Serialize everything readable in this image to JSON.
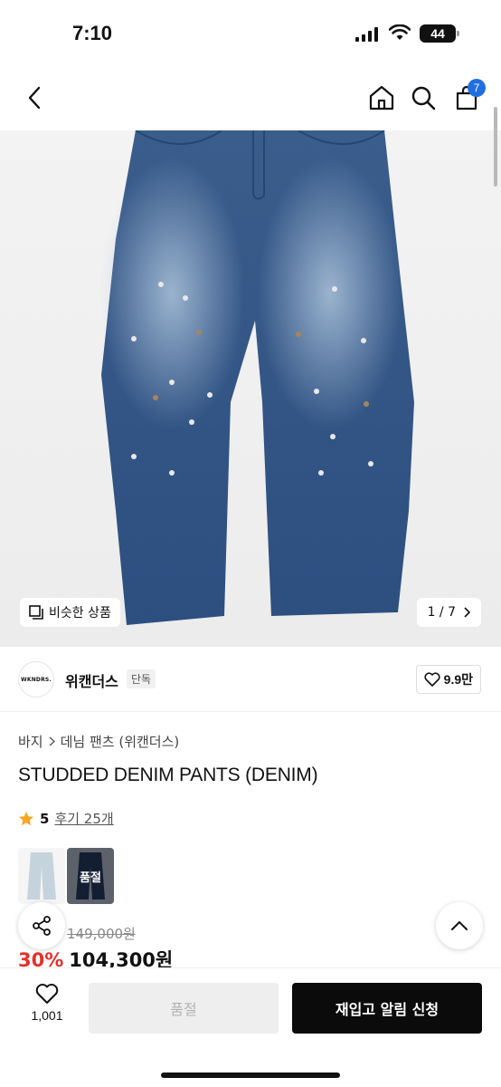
{
  "status_bar": {
    "time": "7:10",
    "battery": "44"
  },
  "nav": {
    "cart_count": "7"
  },
  "gallery": {
    "similar_label": "비슷한 상품",
    "counter": "1 / 7"
  },
  "brand": {
    "logo_text": "WKNDRS.",
    "name": "위캔더스",
    "tag": "단독",
    "likes": "9.9만"
  },
  "breadcrumb": {
    "level1": "바지",
    "level2": "데님 팬츠 (위캔더스)"
  },
  "product": {
    "title": "STUDDED DENIM PANTS (DENIM)",
    "rating": "5",
    "review_link": "후기 25개",
    "colors": [
      {
        "name": "light",
        "soldout": false
      },
      {
        "name": "denim",
        "soldout": true,
        "soldout_label": "품절"
      }
    ],
    "original_price": "149,000원",
    "discount": "30%",
    "sale_price": "104,300원"
  },
  "bottom_bar": {
    "wish_count": "1,001",
    "soldout_label": "품절",
    "restock_label": "재입고 알림 신청"
  },
  "colors": {
    "accent_blue": "#1f6fe0",
    "discount_red": "#e5302b",
    "star": "#f5a623"
  }
}
